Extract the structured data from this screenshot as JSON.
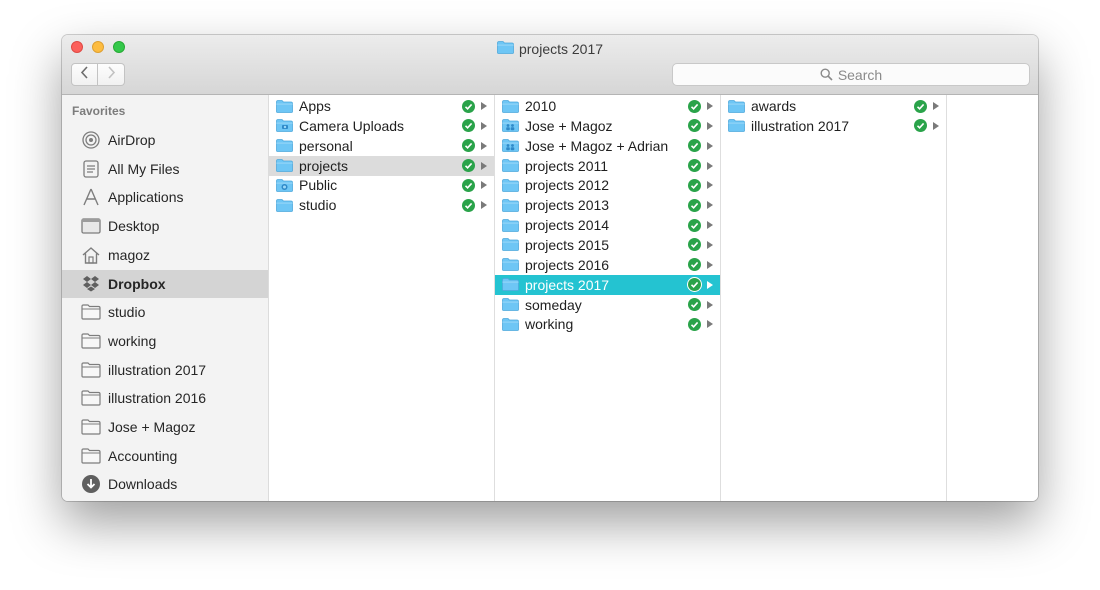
{
  "window": {
    "title": "projects 2017",
    "nav": {
      "back_icon": "chevron-left-icon",
      "forward_icon": "chevron-right-icon"
    },
    "search_placeholder": "Search"
  },
  "colors": {
    "close": "#fc605b",
    "minimize": "#fdbc40",
    "maximize": "#34c84a",
    "selection_active": "#24c3d1",
    "selection_inactive": "#dcdcdc",
    "folder": "#6ec6f5",
    "sync_ok": "#2aa34a"
  },
  "sidebar": {
    "heading": "Favorites",
    "items": [
      {
        "label": "AirDrop",
        "icon": "airdrop-icon"
      },
      {
        "label": "All My Files",
        "icon": "all-files-icon"
      },
      {
        "label": "Applications",
        "icon": "applications-icon"
      },
      {
        "label": "Desktop",
        "icon": "desktop-icon"
      },
      {
        "label": "magoz",
        "icon": "home-icon"
      },
      {
        "label": "Dropbox",
        "icon": "dropbox-icon",
        "selected": true
      },
      {
        "label": "studio",
        "icon": "folder-icon"
      },
      {
        "label": "working",
        "icon": "folder-icon"
      },
      {
        "label": "illustration 2017",
        "icon": "folder-icon"
      },
      {
        "label": "illustration 2016",
        "icon": "folder-icon"
      },
      {
        "label": "Jose + Magoz",
        "icon": "folder-icon"
      },
      {
        "label": "Accounting",
        "icon": "folder-icon"
      },
      {
        "label": "Downloads",
        "icon": "downloads-icon"
      }
    ]
  },
  "columns": [
    {
      "items": [
        {
          "label": "Apps",
          "icon": "folder-icon"
        },
        {
          "label": "Camera Uploads",
          "icon": "camera-folder-icon"
        },
        {
          "label": "personal",
          "icon": "folder-icon"
        },
        {
          "label": "projects",
          "icon": "folder-icon",
          "selected": "inactive"
        },
        {
          "label": "Public",
          "icon": "public-folder-icon"
        },
        {
          "label": "studio",
          "icon": "folder-icon"
        }
      ]
    },
    {
      "items": [
        {
          "label": "2010",
          "icon": "folder-icon"
        },
        {
          "label": "Jose + Magoz",
          "icon": "shared-folder-icon"
        },
        {
          "label": "Jose + Magoz + Adrian",
          "icon": "shared-folder-icon"
        },
        {
          "label": "projects 2011",
          "icon": "folder-icon"
        },
        {
          "label": "projects 2012",
          "icon": "folder-icon"
        },
        {
          "label": "projects 2013",
          "icon": "folder-icon"
        },
        {
          "label": "projects 2014",
          "icon": "folder-icon"
        },
        {
          "label": "projects 2015",
          "icon": "folder-icon"
        },
        {
          "label": "projects 2016",
          "icon": "folder-icon"
        },
        {
          "label": "projects 2017",
          "icon": "folder-icon",
          "selected": "active"
        },
        {
          "label": "someday",
          "icon": "folder-icon"
        },
        {
          "label": "working",
          "icon": "folder-icon"
        }
      ]
    },
    {
      "items": [
        {
          "label": "awards",
          "icon": "folder-icon"
        },
        {
          "label": "illustration 2017",
          "icon": "folder-icon"
        }
      ]
    },
    {
      "items": []
    }
  ]
}
